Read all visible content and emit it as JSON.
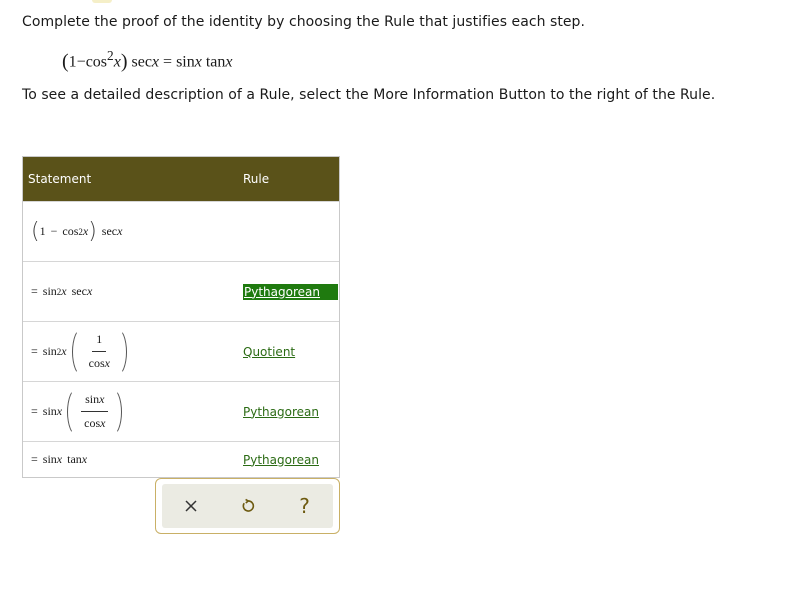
{
  "instructions": {
    "line1": "Complete the proof of the identity by choosing the Rule that justifies each step.",
    "line2": "To see a detailed description of a Rule, select the More Information Button to the right of the Rule."
  },
  "identity": {
    "one": "1",
    "minus": "−",
    "cos": "cos",
    "exp": "2",
    "x": "x",
    "sec": "sec",
    "equals": "=",
    "sin": "sin",
    "tan": "tan"
  },
  "table": {
    "header_statement": "Statement",
    "header_rule": "Rule",
    "rows": [
      {
        "eq": "",
        "rule": ""
      },
      {
        "eq": "=",
        "rule": "Pythagorean"
      },
      {
        "eq": "=",
        "rule": "Quotient"
      },
      {
        "eq": "=",
        "rule": "Pythagorean"
      },
      {
        "eq": "=",
        "rule": "Pythagorean"
      }
    ]
  },
  "math": {
    "one": "1",
    "minus": "−",
    "cos": "cos",
    "sin": "sin",
    "sec": "sec",
    "tan": "tan",
    "x": "x",
    "two": "2"
  },
  "toolbar": {
    "clear_icon": "close-icon",
    "undo_icon": "undo-icon",
    "help_label": "?"
  },
  "colors": {
    "header_bg": "#5a5219",
    "link": "#2b6b14",
    "selected_bg": "#1f7a0f",
    "toolbar_border": "#c9b066",
    "toolbar_bg": "#ebebe3",
    "help_icon": "#6d5a10"
  }
}
